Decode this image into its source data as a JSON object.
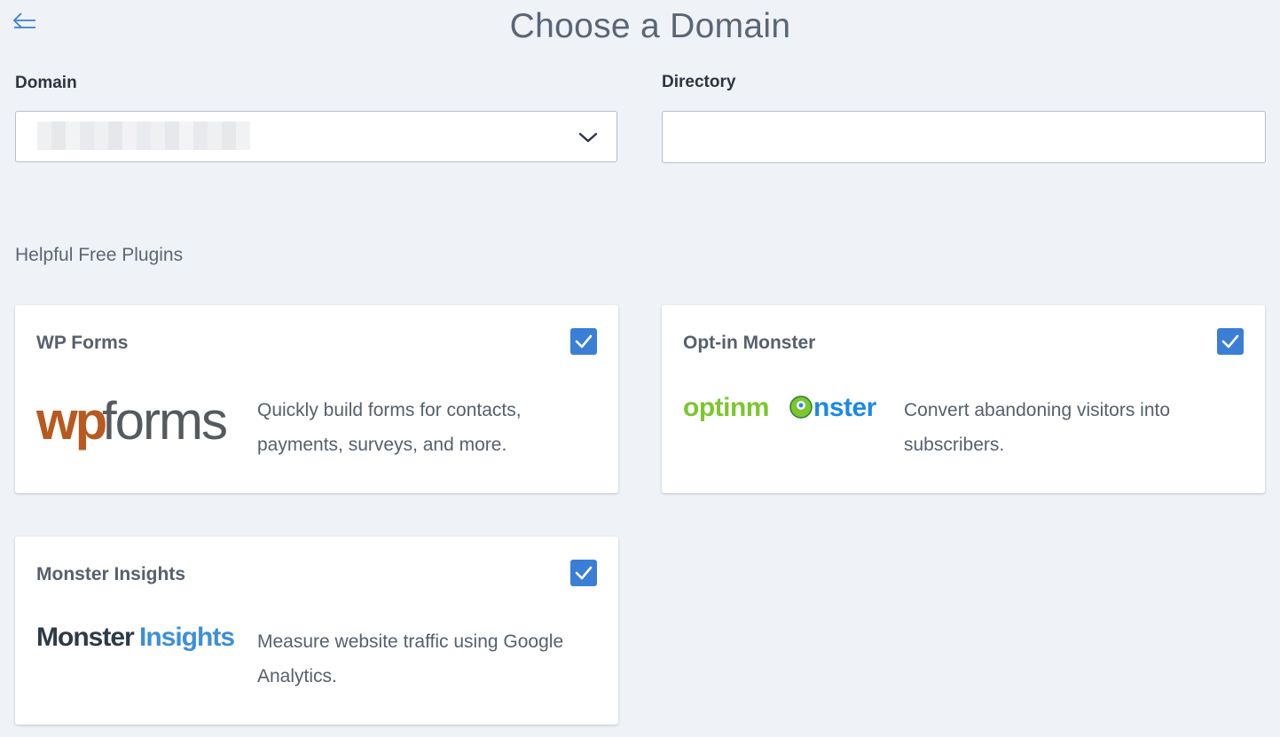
{
  "header": {
    "title": "Choose a Domain",
    "back_icon": "arrow-left-icon"
  },
  "form": {
    "domain_label": "Domain",
    "domain_value": "",
    "directory_label": "Directory",
    "directory_value": ""
  },
  "plugins": {
    "section_title": "Helpful Free Plugins",
    "items": [
      {
        "name": "WP Forms",
        "description": "Quickly build forms for contacts, payments, surveys, and more.",
        "checked": true,
        "logo": {
          "part1": "wp",
          "part2": "forms",
          "color1": "#b85a20",
          "color2": "#555a5f"
        }
      },
      {
        "name": "Opt-in Monster",
        "description": "Convert abandoning visitors into subscribers.",
        "checked": true,
        "logo": {
          "part1": "optinm",
          "part2": "nster",
          "color1": "#7cc62e",
          "color2": "#1e88e5"
        }
      },
      {
        "name": "Monster Insights",
        "description": "Measure website traffic using Google Analytics.",
        "checked": true,
        "logo": {
          "part1": "Monster",
          "part2": "Insights",
          "color1": "#2e3a48",
          "color2": "#3d8fd8"
        }
      }
    ]
  },
  "colors": {
    "accent": "#3a7fd5",
    "background": "#eff2f7"
  }
}
